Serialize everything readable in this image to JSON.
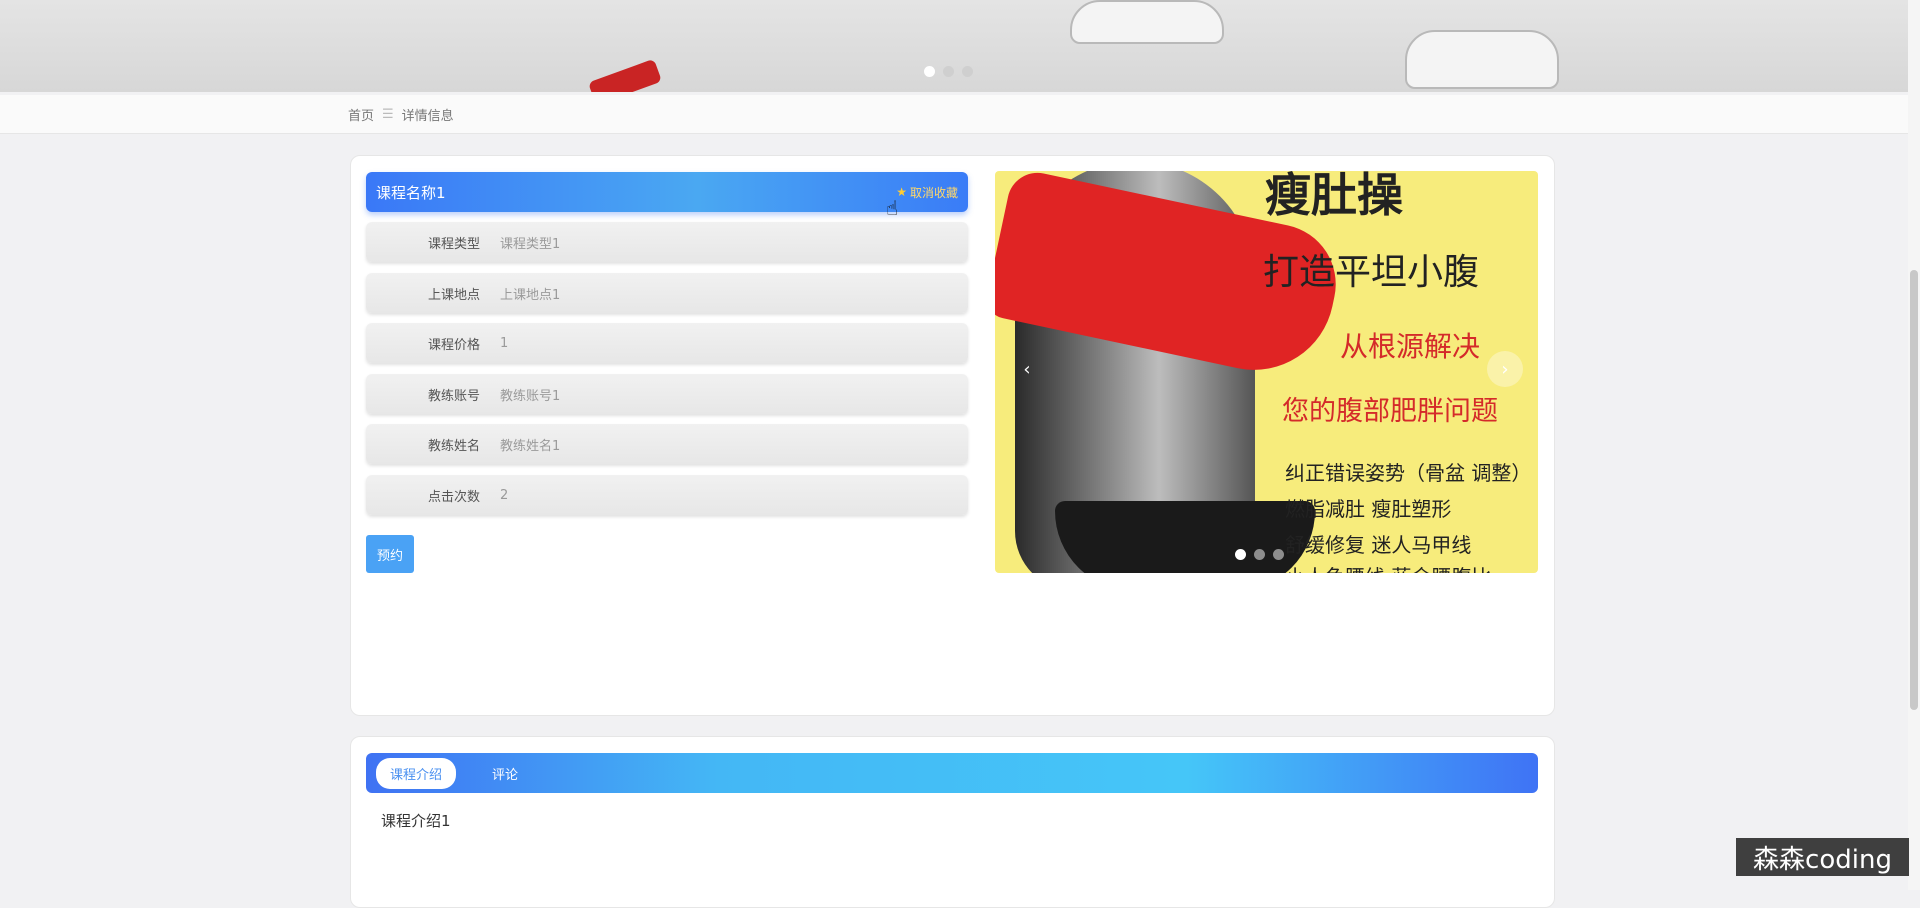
{
  "banner": {
    "dots": 3,
    "active_dot": 0
  },
  "breadcrumb": {
    "home": "首页",
    "separator": "☰",
    "current": "详情信息"
  },
  "course": {
    "title": "课程名称1",
    "favorite_label": "取消收藏",
    "fields": [
      {
        "label": "课程类型",
        "value": "课程类型1"
      },
      {
        "label": "上课地点",
        "value": "上课地点1"
      },
      {
        "label": "课程价格",
        "value": "1"
      },
      {
        "label": "教练账号",
        "value": "教练账号1"
      },
      {
        "label": "教练姓名",
        "value": "教练姓名1"
      },
      {
        "label": "点击次数",
        "value": "2"
      }
    ],
    "book_label": "预约"
  },
  "promo": {
    "lines": [
      "瘦肚操",
      "打造平坦小腹",
      "从根源解决",
      "您的腹部肥胖问题",
      "纠正错误姿势（骨盆 调整）",
      "燃脂减肚 瘦肚塑形",
      "舒缓修复 迷人马甲线",
      "小人鱼腰线 蓝金腰腹比"
    ],
    "prev_icon": "‹",
    "next_icon": "›"
  },
  "tabs": [
    {
      "label": "课程介绍",
      "active": true
    },
    {
      "label": "评论",
      "active": false
    }
  ],
  "intro_text": "课程介绍1",
  "watermark": "森森coding"
}
